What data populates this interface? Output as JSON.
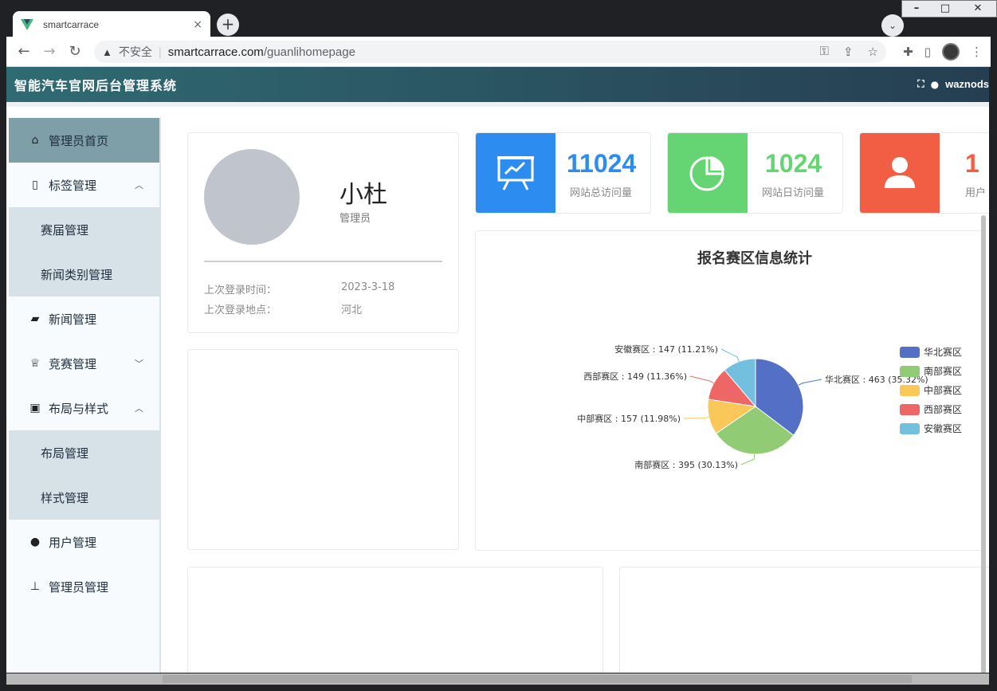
{
  "browser": {
    "tab_title": "smartcarrace",
    "tab_close": "×",
    "new_tab": "+",
    "insecure_label": "不安全",
    "url_host": "smartcarrace.com",
    "url_path": "/guanlihomepage",
    "window_controls": [
      "–",
      "□",
      "✕"
    ],
    "profile_menu_icon": "chevron-down-icon"
  },
  "header": {
    "title": "智能汽车官网后台管理系统",
    "username": "waznods"
  },
  "sidebar": {
    "items": [
      {
        "label": "管理员首页",
        "icon": "home-icon",
        "active": true
      },
      {
        "label": "标签管理",
        "icon": "book-icon",
        "expanded": true
      },
      {
        "label": "赛届管理",
        "sub": true
      },
      {
        "label": "新闻类别管理",
        "sub": true
      },
      {
        "label": "新闻管理",
        "icon": "camera-icon"
      },
      {
        "label": "竞赛管理",
        "icon": "trophy-icon",
        "expanded": false
      },
      {
        "label": "布局与样式",
        "icon": "image-icon",
        "expanded": true
      },
      {
        "label": "布局管理",
        "sub": true
      },
      {
        "label": "样式管理",
        "sub": true
      },
      {
        "label": "用户管理",
        "icon": "user-icon"
      },
      {
        "label": "管理员管理",
        "icon": "stamp-icon"
      }
    ]
  },
  "profile": {
    "name": "小杜",
    "role": "管理员",
    "last_login_time_label": "上次登录时间：",
    "last_login_time": "2023-3-18",
    "last_login_place_label": "上次登录地点：",
    "last_login_place": "河北"
  },
  "stats": [
    {
      "value": "11024",
      "label": "网站总访问量",
      "color": "#2d8cf0",
      "icon": "presentation-chart-icon"
    },
    {
      "value": "1024",
      "label": "网站日访问量",
      "color": "#64d572",
      "icon": "pie-chart-icon"
    },
    {
      "value": "1",
      "label": "用户",
      "color": "#f25e43",
      "icon": "user-icon"
    }
  ],
  "chart_data": {
    "type": "pie",
    "title": "报名赛区信息统计",
    "categories": [
      "华北赛区",
      "南部赛区",
      "中部赛区",
      "西部赛区",
      "安徽赛区"
    ],
    "values": [
      463,
      395,
      157,
      149,
      147
    ],
    "labels": [
      "华北赛区 : 463 (35.32%)",
      "南部赛区 : 395 (30.13%)",
      "中部赛区 : 157 (11.98%)",
      "西部赛区 : 149 (11.36%)",
      "安徽赛区 : 147 (11.21%)"
    ],
    "colors": [
      "#5470c6",
      "#91cc75",
      "#fac858",
      "#ee6666",
      "#73c0de"
    ],
    "legend_position": "right"
  }
}
